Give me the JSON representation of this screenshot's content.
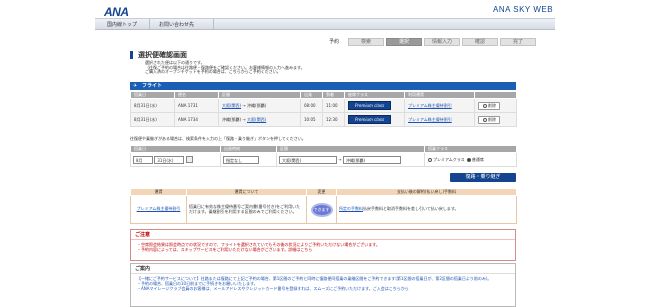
{
  "header": {
    "logo_ana": "ANA",
    "logo_skyweb": "ANA SKY WEB",
    "nav": [
      "国内線トップ",
      "お問い合わせ先"
    ]
  },
  "steps": [
    "予約",
    "検索",
    "選択",
    "情報入力",
    "確認",
    "完了"
  ],
  "page": {
    "title": "選択便確認画面",
    "intro_lines": [
      "選択された便は以下の通りです。",
      "（往復ご予約の場合は往路便・復路便をご確認ください。お客様情報の入力へ進みます。",
      "ご購入済のオープンチケットを予約の場合は、こちらからご予約ください。"
    ]
  },
  "flight_section": {
    "title": "フライト",
    "columns": [
      "搭乗日",
      "便名",
      "区間",
      "出発",
      "到着",
      "座席クラス",
      "利用運賃",
      ""
    ],
    "rows": [
      {
        "date": "8月31日(水)",
        "flight": "ANA 1731",
        "from": "大阪(関西)",
        "arrow": "→",
        "to": "沖縄(那覇)",
        "dep": "08:00",
        "arr": "11:00",
        "seat": "Premium class",
        "fare": "プレミアム株主優待割引",
        "action": "削除"
      },
      {
        "date": "8月31日(水)",
        "flight": "ANA 1734",
        "from": "沖縄(那覇)",
        "arrow": "→",
        "to": "大阪(関西)",
        "dep": "10:05",
        "arr": "12:30",
        "seat": "Premium class",
        "fare": "プレミアム株主優待割引",
        "action": "削除"
      }
    ]
  },
  "search_section": {
    "note": "往復便や乗継ぎがある場合は、検索条件を入力の上「復路・乗り継ぎ」ボタンを押してください。",
    "columns": [
      "搭乗日",
      "出発時刻",
      "区間",
      "搭乗クラス"
    ],
    "month": "8月",
    "day": "31日(水)",
    "time": "指定なし",
    "from": "大阪(関西)",
    "to": "沖縄(那覇)",
    "class_premium": "プレミアムクラス",
    "class_normal": "普通席",
    "button": "復路・乗り継ぎ"
  },
  "fare_section": {
    "columns": [
      "運賃",
      "運賃について",
      "変更",
      "支払い後の解約(払い戻し)手数料"
    ],
    "fare_name": "プレミアム株主優待割引",
    "fare_desc": "搭乗日に有効な株主優待番号ご案内書(番号付き)をご利用いただけます。乗継割引を利用する区間のみでご利用ください。",
    "change": "できます",
    "cancel_link": "所定の手数料",
    "cancel_desc": "払戻手数料と取消手数料を差し引いて払い戻します。"
  },
  "caution": {
    "title": "ご注意",
    "lines": [
      "・空席照会結果は照会時点での状況ですので、フライトを選択されていてもその後の状況によりご予約いただけない場合がございます。",
      "・予約内容によっては、スキップサービスをご利用いただけない場合がございます。詳細はこちら"
    ]
  },
  "guide": {
    "title": "ご案内",
    "lines": [
      "【一緒にご予約サービスについて】往路または復路にて上記ご予約の場合、第1区間のご予約と同時に復路便同搭乗の乗継区間をご予約できます(第1区間の搭乗日が、第2区間の搭乗日より前のみ)。",
      "・予約の場合、搭乗日の10日前までに手続きをお願いいたします。",
      "・ANAマイレージクラブ会員のお客様は、メールアドレスやクレジットカード番号を登録すれば、スムーズにご予約いただけます。ご入会はこちらから"
    ]
  }
}
